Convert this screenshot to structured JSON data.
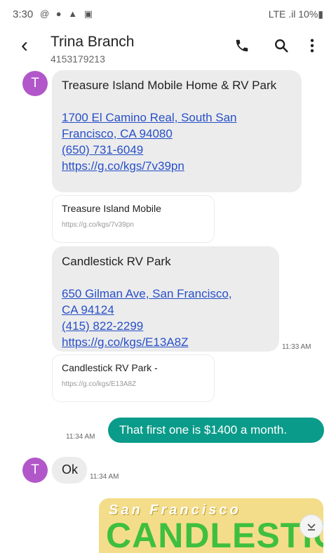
{
  "status": {
    "time": "3:30",
    "left_icons": "@ ● ▲ ▣",
    "right": "LTE .il 10%▮"
  },
  "header": {
    "back_icon": "chevron-left",
    "contact_name": "Trina Branch",
    "contact_number": "4153179213",
    "actions": [
      "phone-icon",
      "search-icon",
      "more-vert-icon"
    ]
  },
  "messages": [
    {
      "title": "Treasure Island Mobile Home & RV Park",
      "address_line1": "1700 El Camino Real, South San",
      "address_line2": "Francisco, CA 94080",
      "phone": "(650) 731-6049",
      "url": "https://g.co/kgs/7v39pn",
      "preview_title": "Treasure Island Mobile",
      "preview_url": "https://g.co/kgs/7v39pn"
    },
    {
      "title": "Candlestick RV Park",
      "address_line1": "650 Gilman Ave, San Francisco,",
      "address_line2": "CA 94124",
      "phone": "(415) 822-2299",
      "url": "https://g.co/kgs/E13A8Z",
      "time": "11:33 AM",
      "preview_title": "Candlestick RV Park -",
      "preview_url": "https://g.co/kgs/E13A8Z"
    }
  ],
  "sent": {
    "text": "That first one is $1400 a month.",
    "time": "11:34 AM"
  },
  "reply": {
    "text": "Ok",
    "time": "11:34 AM"
  },
  "avatar_letter": "T",
  "image_message": {
    "line1": "San Francisco",
    "line2": "CANDLESTICK"
  },
  "colors": {
    "avatar": "#b157c9",
    "sent_bubble": "#0b9b8a",
    "link": "#2850c8",
    "received_bubble": "#ececec"
  }
}
